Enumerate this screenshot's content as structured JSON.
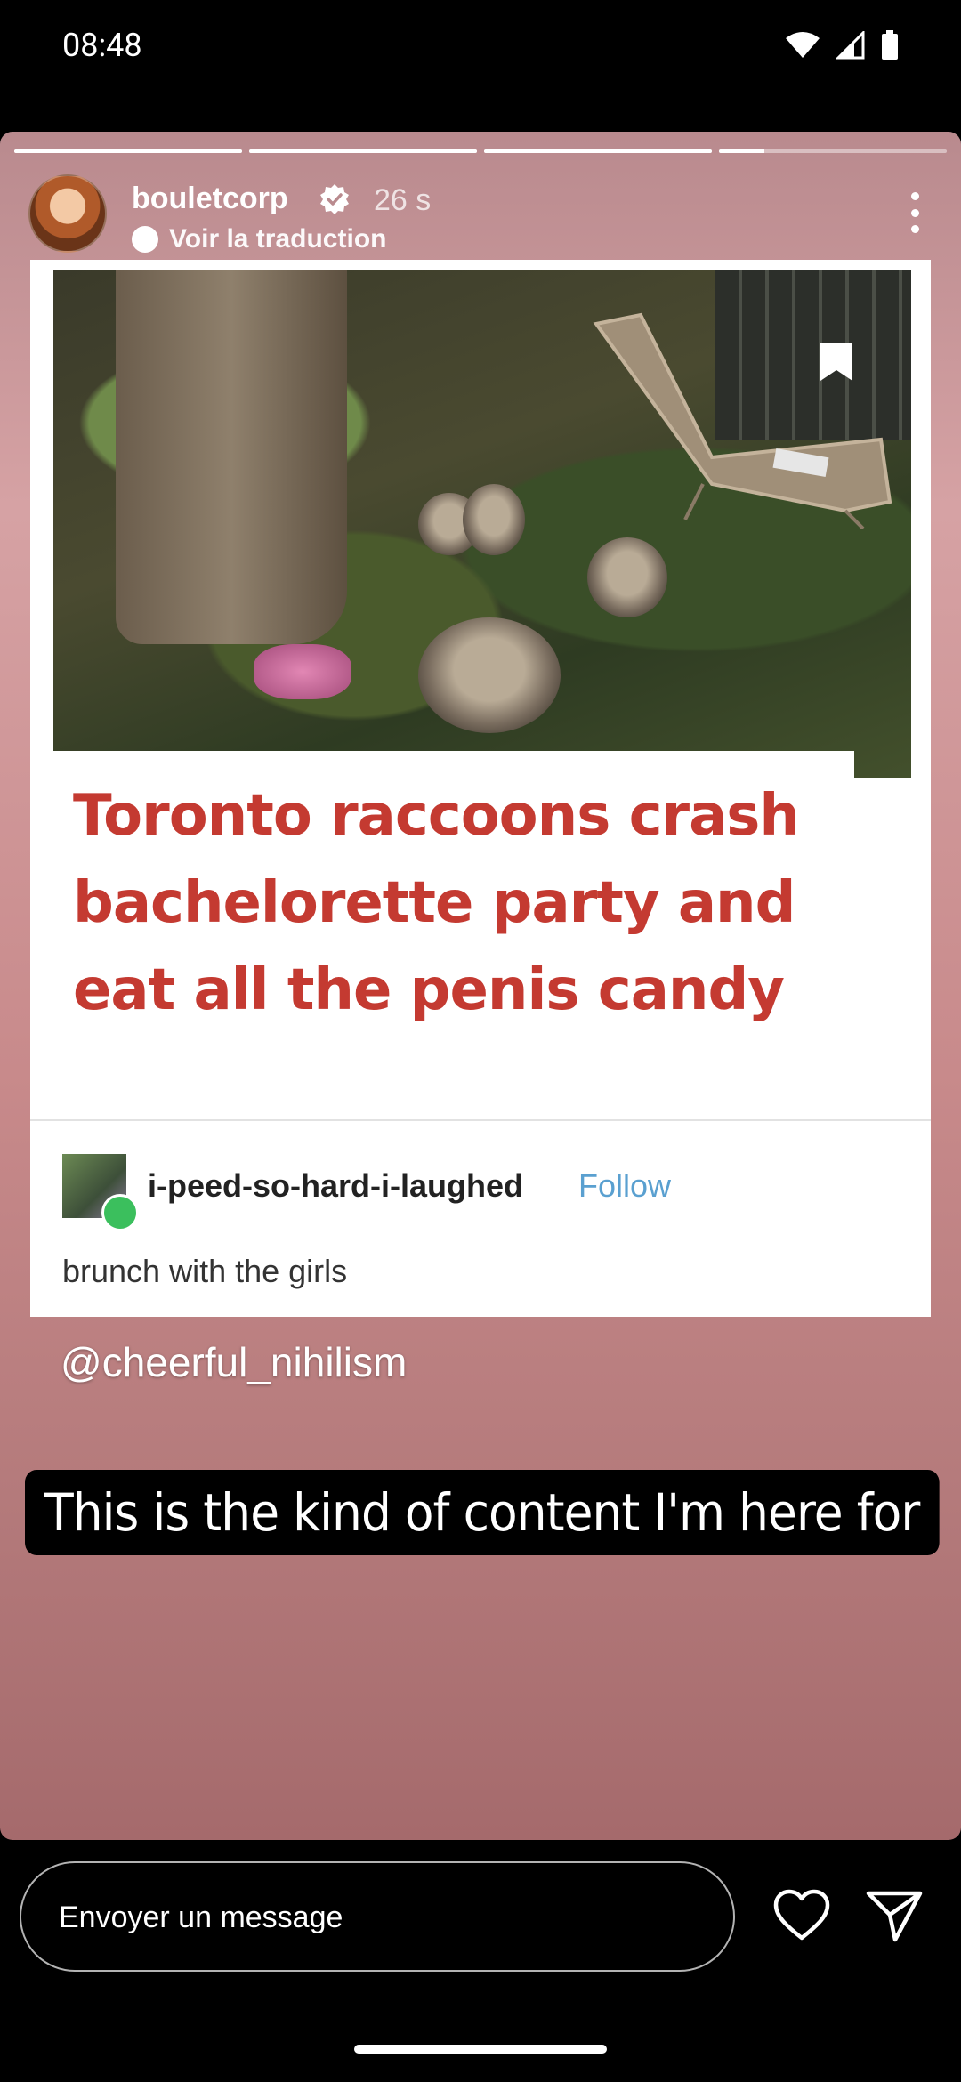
{
  "status_bar": {
    "time": "08:48"
  },
  "story": {
    "progress_segments": [
      1.0,
      1.0,
      1.0,
      0.2
    ],
    "user": {
      "username": "bouletcorp",
      "verified": true,
      "time_ago": "26 s",
      "translate_label": "Voir la traduction"
    },
    "post": {
      "headline_lines": [
        "Toronto raccoons crash",
        "bachelorette party and",
        "eat all the penis candy"
      ],
      "tumblr_user": "i-peed-so-hard-i-laughed",
      "follow_label": "Follow",
      "caption": "brunch with the girls"
    },
    "mention": "@cheerful_nihilism",
    "overlay_text": "This is the kind of content I'm here for"
  },
  "message_bar": {
    "placeholder": "Envoyer un message"
  },
  "icons": {
    "like": "heart-icon",
    "send": "send-icon",
    "more": "more-vertical-icon",
    "verified": "verified-badge-icon"
  }
}
